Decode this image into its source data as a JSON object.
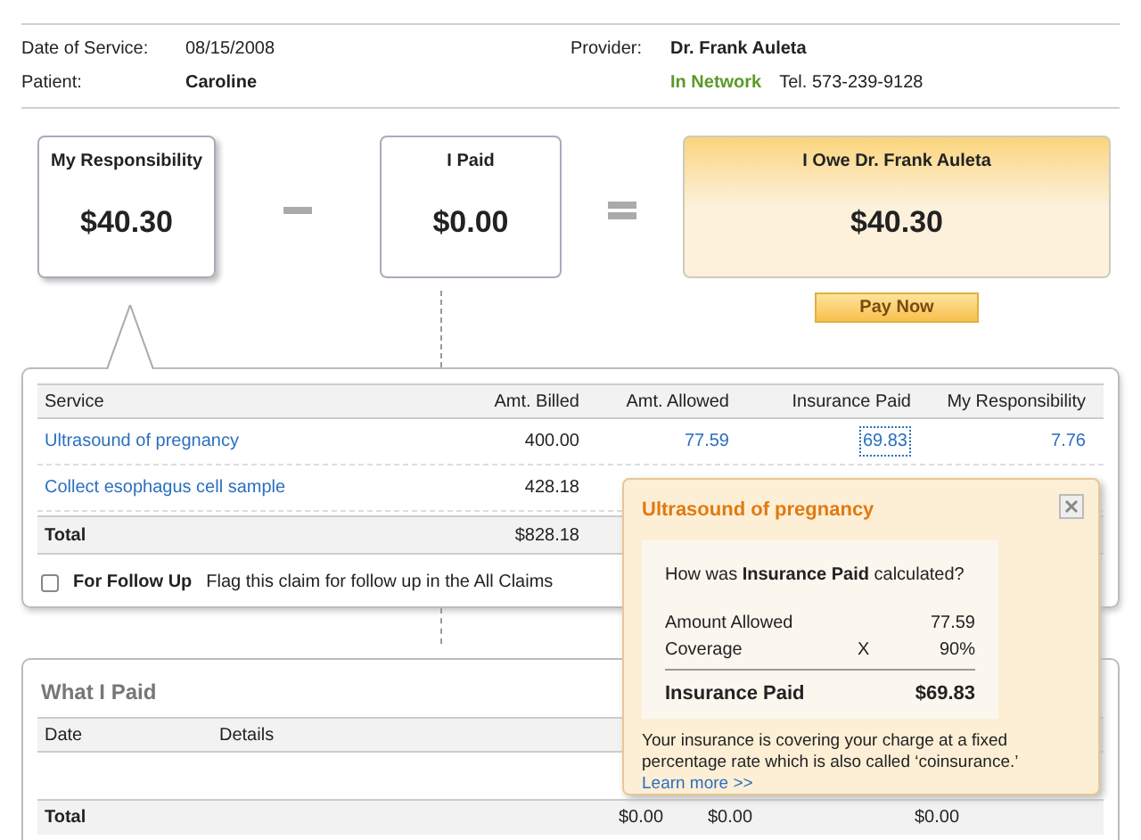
{
  "claim_info": {
    "date_label": "Date of Service:",
    "date": "08/15/2008",
    "patient_label": "Patient:",
    "patient": "Caroline",
    "provider_label": "Provider:",
    "provider": "Dr. Frank Auleta",
    "network": "In Network",
    "phone": "Tel. 573-239-9128"
  },
  "summary": {
    "responsibility_label": "My Responsibility",
    "responsibility": "$40.30",
    "paid_label": "I Paid",
    "paid": "$0.00",
    "owe_label": "I Owe Dr. Frank Auleta",
    "owe": "$40.30",
    "pay_button": "Pay Now"
  },
  "services": {
    "columns": [
      "Service",
      "Amt. Billed",
      "Amt. Allowed",
      "Insurance Paid",
      "My Responsibility"
    ],
    "rows": [
      {
        "service": "Ultrasound of pregnancy",
        "billed": "400.00",
        "allowed": "77.59",
        "insurance_paid": {
          "text": "69.83",
          "selected": true
        },
        "responsibility": "7.76"
      },
      {
        "service": "Collect esophagus cell sample",
        "billed": "428.18"
      }
    ],
    "total_label": "Total",
    "total_billed": "$828.18",
    "follow_up": {
      "checked": false,
      "label": "For Follow Up",
      "description": "Flag this claim for follow up in the All Claims"
    }
  },
  "what_i_paid": {
    "title": "What I Paid",
    "columns": [
      "Date",
      "Details"
    ],
    "total_label": "Total",
    "totals": [
      "$0.00",
      "$0.00",
      "$0.00"
    ]
  },
  "popup": {
    "title": "Ultrasound of pregnancy",
    "question": "How was **Insurance Paid** calculated?",
    "lines": [
      {
        "label": "Amount Allowed",
        "value": "77.59"
      },
      {
        "label": "Coverage",
        "operator": "X",
        "value": "90%"
      }
    ],
    "result_label": "Insurance Paid",
    "result": "$69.83",
    "explanation": "Your insurance is covering your charge at a fixed percentage rate which is also called ‘coinsurance.’",
    "link": "Learn more >>"
  }
}
